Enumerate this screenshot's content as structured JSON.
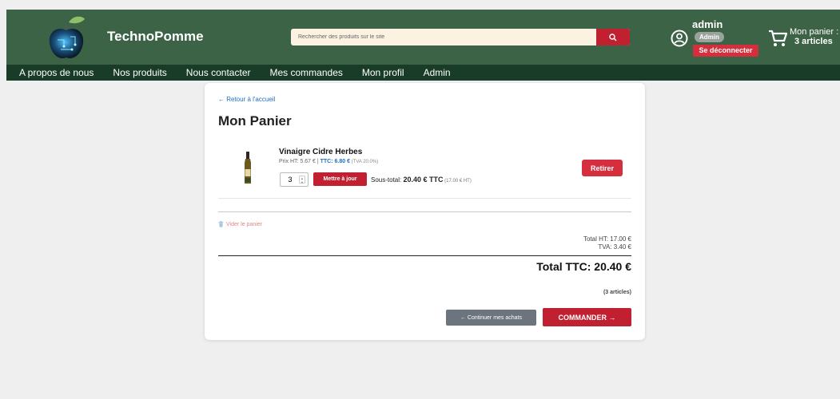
{
  "header": {
    "brand": "TechnoPomme",
    "search": {
      "placeholder": "Rechercher des produits sur le site"
    },
    "user": {
      "name": "admin",
      "role_badge": "Admin",
      "logout_label": "Se déconnecter"
    },
    "cart": {
      "label": "Mon panier :",
      "count": "3 articles"
    }
  },
  "nav": {
    "items": [
      "A propos de nous",
      "Nos produits",
      "Nous contacter",
      "Mes commandes",
      "Mon profil",
      "Admin"
    ]
  },
  "cart_page": {
    "back_link": "← Retour à l'accueil",
    "title": "Mon Panier",
    "items": [
      {
        "name": "Vinaigre Cidre Herbes",
        "price_ht_text": "Prix HT: 5.67 € | ",
        "price_ttc_text": "TTC: 6.80 €",
        "tva_text": " (TVA 20.0%)",
        "quantity": "3",
        "update_label": "Mettre à jour",
        "subtotal_label": "Sous-total: ",
        "subtotal_ttc": "20.40 € TTC",
        "subtotal_ht": " (17.00 € HT)",
        "remove_label": "Retirer"
      }
    ],
    "clear_label": "Vider le panier",
    "total_ht": "Total HT: 17.00 €",
    "tva": "TVA: 3.40 €",
    "total_ttc": "Total TTC: 20.40 €",
    "article_count": "(3 articles)",
    "continue_label": "← Continuer mes achats",
    "order_label": "COMMANDER →"
  },
  "colors": {
    "header_bg": "#3d6347",
    "nav_bg": "#193c28",
    "accent_red": "#c0202f",
    "link_blue": "#1a6fc6",
    "search_bg": "#fbf2e1"
  },
  "icons": {
    "logo": "apple-logo-icon",
    "search": "search-icon",
    "user": "user-circle-icon",
    "cart": "shopping-cart-icon",
    "trash": "trash-icon"
  }
}
